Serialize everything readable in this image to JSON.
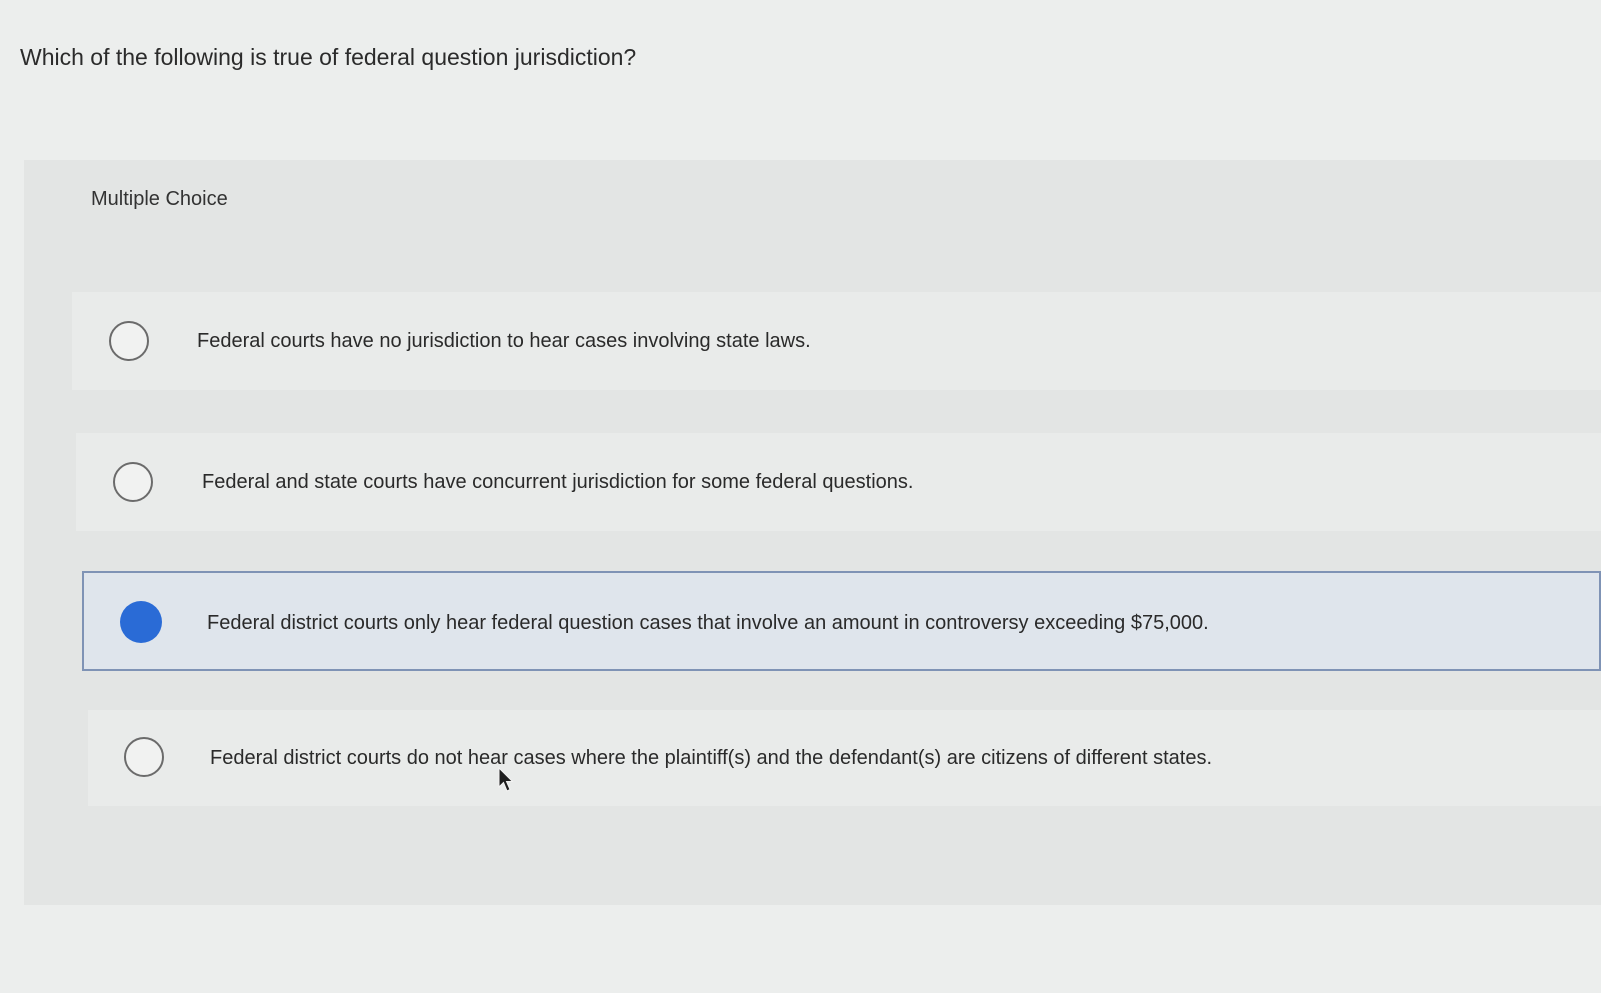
{
  "question": {
    "text": "Which of the following is true of federal question jurisdiction?"
  },
  "panel": {
    "type_label": "Multiple Choice"
  },
  "options": [
    {
      "text": "Federal courts have no jurisdiction to hear cases involving state laws.",
      "selected": false
    },
    {
      "text": "Federal and state courts have concurrent jurisdiction for some federal questions.",
      "selected": false
    },
    {
      "text": "Federal district courts only hear federal question cases that involve an amount in controversy exceeding $75,000.",
      "selected": true
    },
    {
      "text": "Federal district courts do not hear cases where the plaintiff(s) and the defendant(s) are citizens of different states.",
      "selected": false
    }
  ],
  "colors": {
    "selected_radio": "#2a6bd6",
    "selected_border": "#7f93b5",
    "background": "#eceeed"
  }
}
